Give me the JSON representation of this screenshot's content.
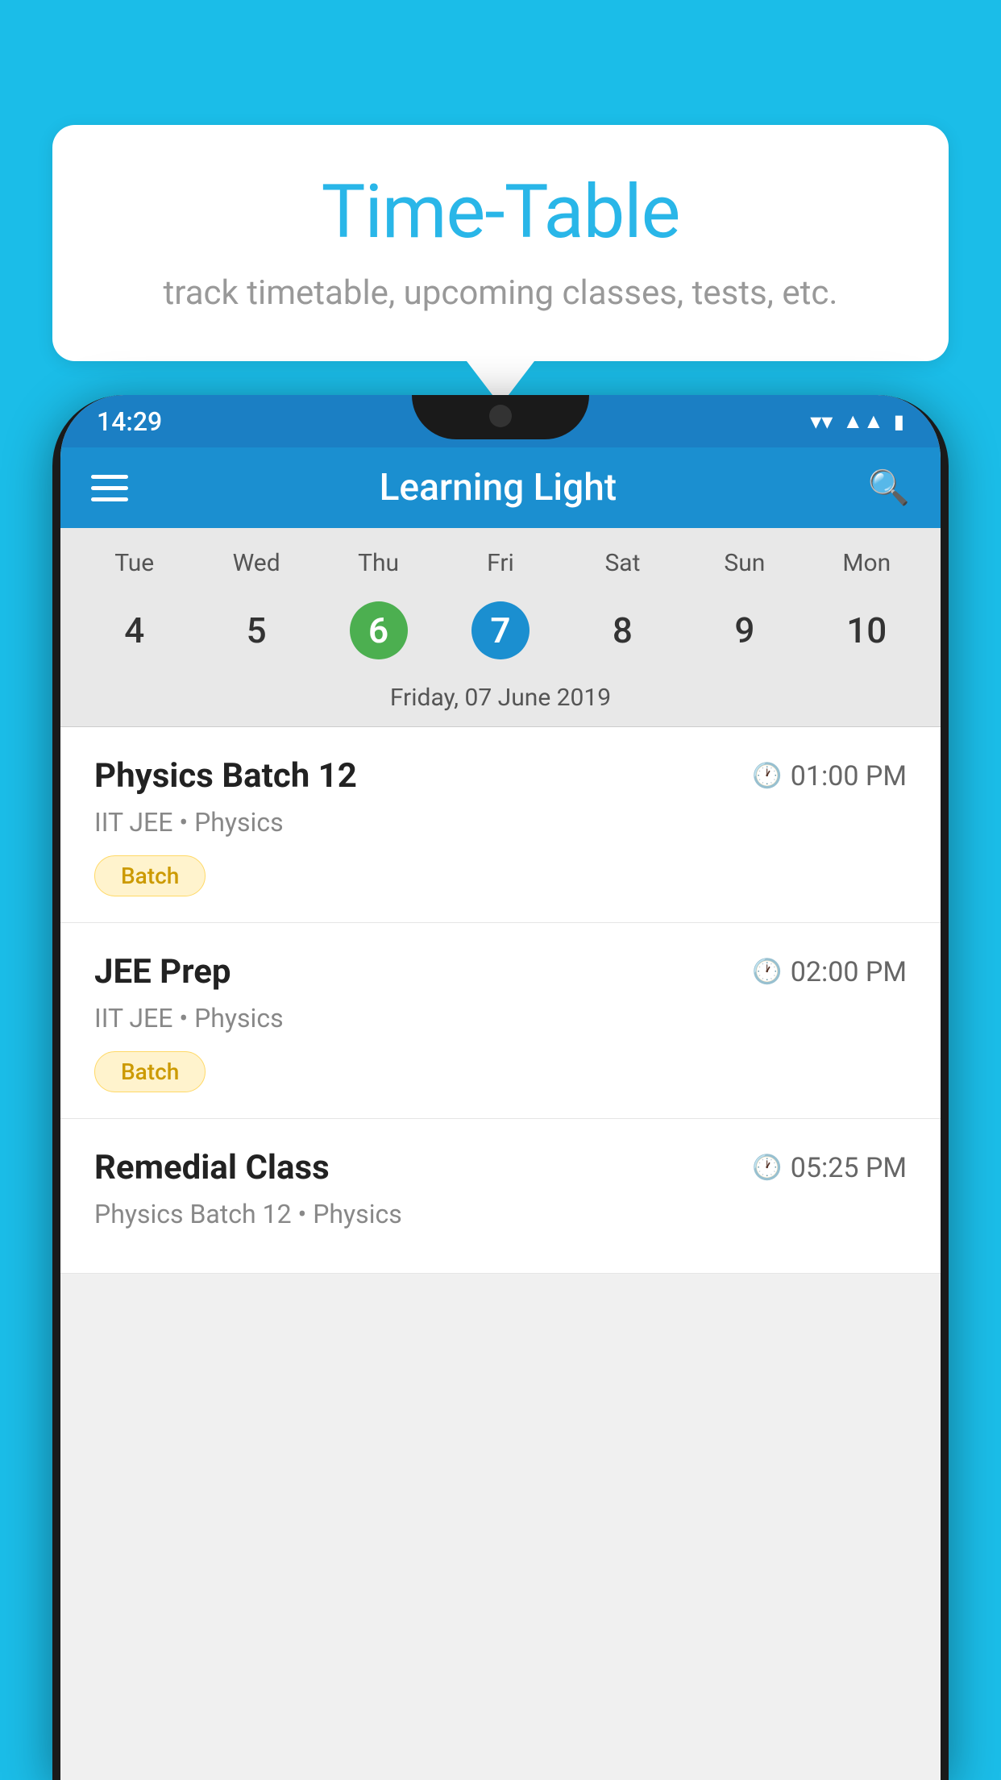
{
  "background_color": "#1BBDE8",
  "speech_bubble": {
    "title": "Time-Table",
    "subtitle": "track timetable, upcoming classes, tests, etc."
  },
  "phone": {
    "status_bar": {
      "time": "14:29"
    },
    "app_bar": {
      "title": "Learning Light",
      "search_placeholder": "Search"
    },
    "calendar": {
      "days": [
        {
          "label": "Tue",
          "number": "4"
        },
        {
          "label": "Wed",
          "number": "5"
        },
        {
          "label": "Thu",
          "number": "6",
          "style": "green"
        },
        {
          "label": "Fri",
          "number": "7",
          "style": "blue"
        },
        {
          "label": "Sat",
          "number": "8"
        },
        {
          "label": "Sun",
          "number": "9"
        },
        {
          "label": "Mon",
          "number": "10"
        }
      ],
      "selected_date": "Friday, 07 June 2019"
    },
    "schedule": [
      {
        "title": "Physics Batch 12",
        "time": "01:00 PM",
        "subtitle": "IIT JEE • Physics",
        "tag": "Batch"
      },
      {
        "title": "JEE Prep",
        "time": "02:00 PM",
        "subtitle": "IIT JEE • Physics",
        "tag": "Batch"
      },
      {
        "title": "Remedial Class",
        "time": "05:25 PM",
        "subtitle": "Physics Batch 12 • Physics",
        "tag": ""
      }
    ]
  }
}
